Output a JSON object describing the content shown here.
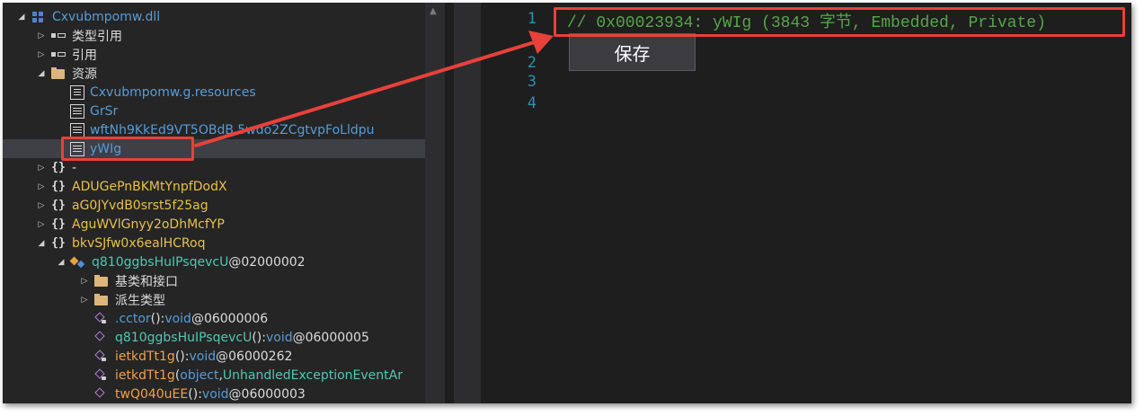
{
  "tree": {
    "rows": [
      {
        "label": "Cxvubmpomw.dll"
      },
      {
        "label": "类型引用"
      },
      {
        "label": "引用"
      },
      {
        "label": "资源"
      },
      {
        "label": "Cxvubmpomw.g.resources"
      },
      {
        "label": "GrSr"
      },
      {
        "label": "wftNh9KkEd9VT5OBdB.5wdo2ZCgtvpFoLldpu"
      },
      {
        "label": "yWIg"
      },
      {
        "label": "-"
      },
      {
        "label": "ADUGePnBKMtYnpfDodX"
      },
      {
        "label": "aG0JYvdB0srst5f25ag"
      },
      {
        "label": "AguWVlGnyy2oDhMcfYP"
      },
      {
        "label": "bkvSJfw0x6ealHCRoq"
      },
      {
        "label": "q810ggbsHuIPsqevcU",
        "suffix": " @02000002"
      },
      {
        "label": "基类和接口"
      },
      {
        "label": "派生类型"
      },
      {
        "label": ".cctor",
        "sig": "()",
        "sep": " : ",
        "ret": "void",
        "suffix": " @06000006"
      },
      {
        "label": "q810ggbsHuIPsqevcU",
        "sig": "()",
        "sep": " : ",
        "ret": "void",
        "suffix": " @06000005"
      },
      {
        "label": "ietkdTt1g",
        "sig": "()",
        "sep": " : ",
        "ret": "void",
        "suffix": " @06000262"
      },
      {
        "label": "ietkdTt1g",
        "sig": "(",
        "arg1": "object",
        "comma": ", ",
        "arg2": "UnhandledExceptionEventAr"
      },
      {
        "label": "twQ040uEE",
        "sig": "()",
        "sep": " : ",
        "ret": "void",
        "suffix": " @06000003"
      }
    ]
  },
  "editor": {
    "line_numbers": [
      "1",
      "2",
      "3",
      "4"
    ],
    "code_line": "// 0x00023934: yWIg (3843 字节, Embedded, Private)",
    "save_label": "保存"
  },
  "colors": {
    "annotation": "#e8413a",
    "comment": "#57a64a",
    "line_number": "#2b91af"
  }
}
